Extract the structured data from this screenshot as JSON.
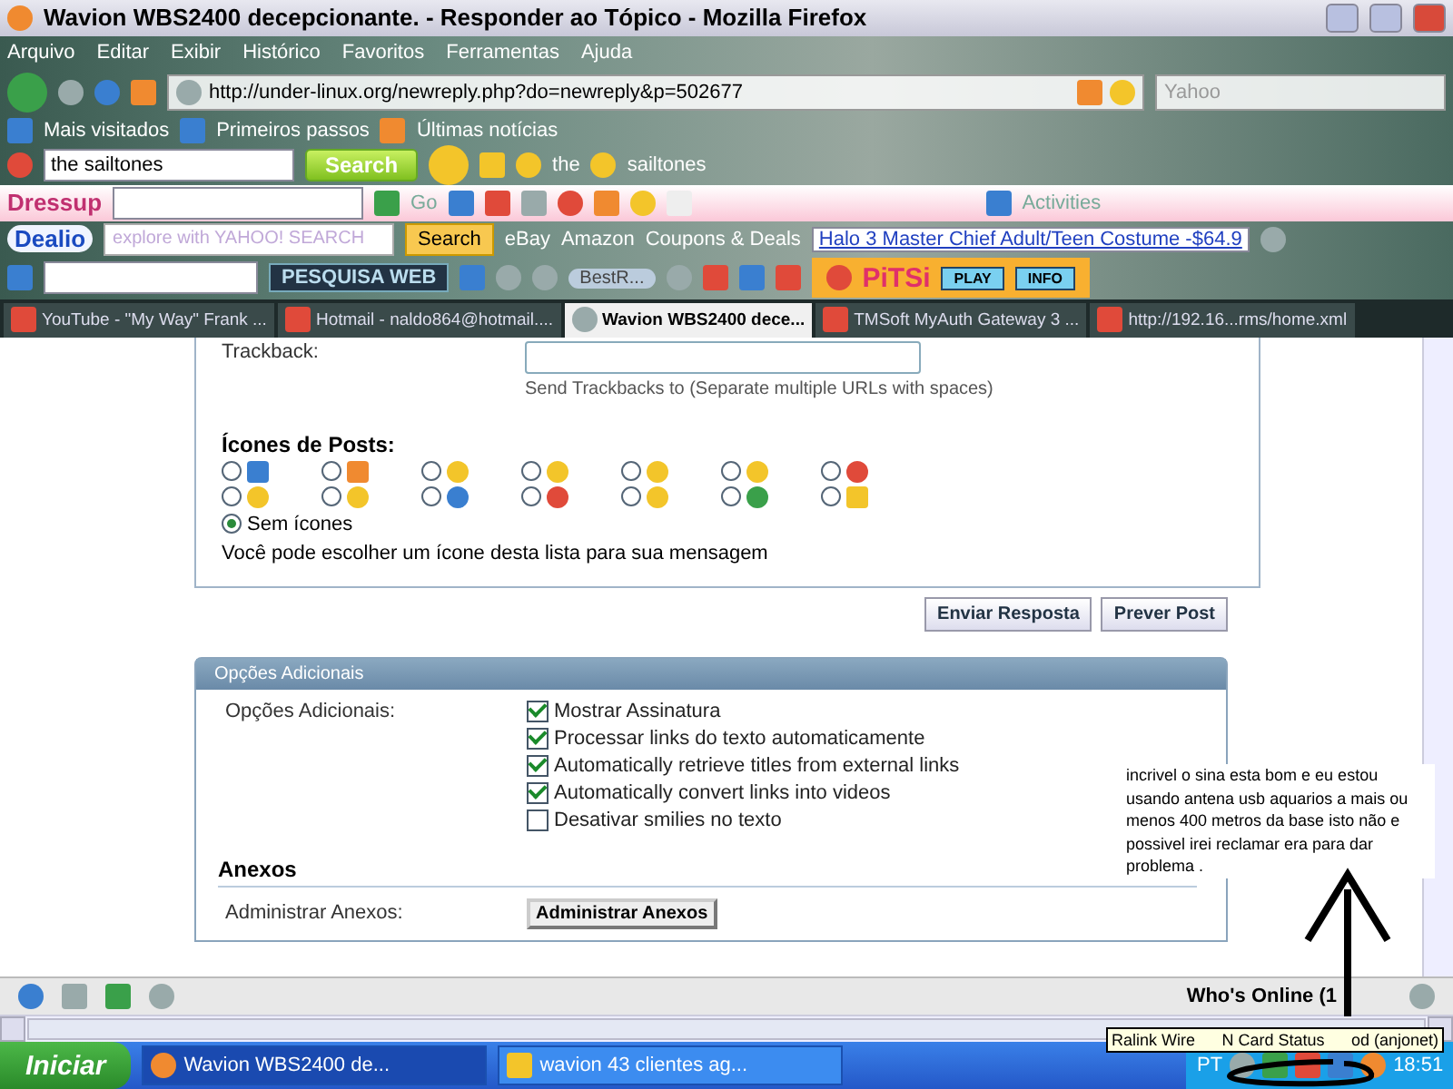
{
  "window": {
    "title": "Wavion WBS2400 decepcionante. - Responder ao Tópico - Mozilla Firefox"
  },
  "menu": [
    "Arquivo",
    "Editar",
    "Exibir",
    "Histórico",
    "Favoritos",
    "Ferramentas",
    "Ajuda"
  ],
  "address": {
    "url": "http://under-linux.org/newreply.php?do=newreply&p=502677",
    "search_placeholder": "Yahoo"
  },
  "bookmarks": [
    "Mais visitados",
    "Primeiros passos",
    "Últimas notícias"
  ],
  "toolbar_sailtones": {
    "query": "the sailtones",
    "search": "Search",
    "words": [
      "the",
      "sailtones"
    ]
  },
  "toolbar_dressup": {
    "brand": "Dressup",
    "go": "Go",
    "activities": "Activities"
  },
  "toolbar_dealio": {
    "brand": "Dealio",
    "placeholder": "explore with YAHOO! SEARCH",
    "search": "Search",
    "links": [
      "eBay",
      "Amazon",
      "Coupons & Deals"
    ],
    "ticker": "Halo 3 Master Chief Adult/Teen Costume -$64.9"
  },
  "toolbar_pesquisa": {
    "button": "PESQUISA WEB",
    "station": "BestR...",
    "banner": "PiTSi",
    "banner_buttons": [
      "PLAY",
      "INFO"
    ]
  },
  "tabs": [
    {
      "label": "YouTube - \"My Way\" Frank ...",
      "selected": false
    },
    {
      "label": "Hotmail - naldo864@hotmail....",
      "selected": false
    },
    {
      "label": "Wavion WBS2400 dece...",
      "selected": true
    },
    {
      "label": "TMSoft MyAuth Gateway 3 ...",
      "selected": false
    },
    {
      "label": "http://192.16...rms/home.xml",
      "selected": false
    }
  ],
  "form": {
    "trackback_label": "Trackback:",
    "trackback_hint": "Send Trackbacks to (Separate multiple URLs with spaces)",
    "icons_heading": "Ícones de Posts:",
    "icon_options": [
      {
        "selected": false
      },
      {
        "selected": false
      },
      {
        "selected": false
      },
      {
        "selected": false
      },
      {
        "selected": false
      },
      {
        "selected": false
      },
      {
        "selected": false
      },
      {
        "selected": false
      },
      {
        "selected": false
      },
      {
        "selected": false
      },
      {
        "selected": false
      },
      {
        "selected": false
      },
      {
        "selected": false
      },
      {
        "selected": false
      }
    ],
    "no_icon": {
      "label": "Sem ícones",
      "selected": true
    },
    "icons_hint": "Você pode escolher um ícone desta lista para sua mensagem"
  },
  "buttons": [
    "Enviar Resposta",
    "Prever Post"
  ],
  "options_panel": {
    "title": "Opções Adicionais",
    "label": "Opções Adicionais:",
    "checkboxes": [
      {
        "label": "Mostrar Assinatura",
        "checked": true
      },
      {
        "label": "Processar links do texto automaticamente",
        "checked": true
      },
      {
        "label": "Automatically retrieve titles from external links",
        "checked": true
      },
      {
        "label": "Automatically convert links into videos",
        "checked": true
      },
      {
        "label": "Desativar smilies no texto",
        "checked": false
      }
    ],
    "attachments_heading": "Anexos",
    "attachments_label": "Administrar Anexos:",
    "attachments_button": "Administrar Anexos"
  },
  "addon_bar": {
    "whos_online": "Who's Online (1"
  },
  "annotation": {
    "note": "incrivel o sina esta bom e eu estou usando antena usb aquarios a mais ou menos 400 metros da base isto não e possivel irei reclamar era para dar problema ."
  },
  "tooltip": [
    "Ralink Wire",
    "N Card Status",
    "od (anjonet)"
  ],
  "taskbar": {
    "start": "Iniciar",
    "tasks": [
      {
        "label": "Wavion WBS2400 de...",
        "selected": true
      },
      {
        "label": "wavion 43 clientes ag...",
        "selected": false
      }
    ],
    "lang": "PT",
    "clock": "18:51"
  }
}
